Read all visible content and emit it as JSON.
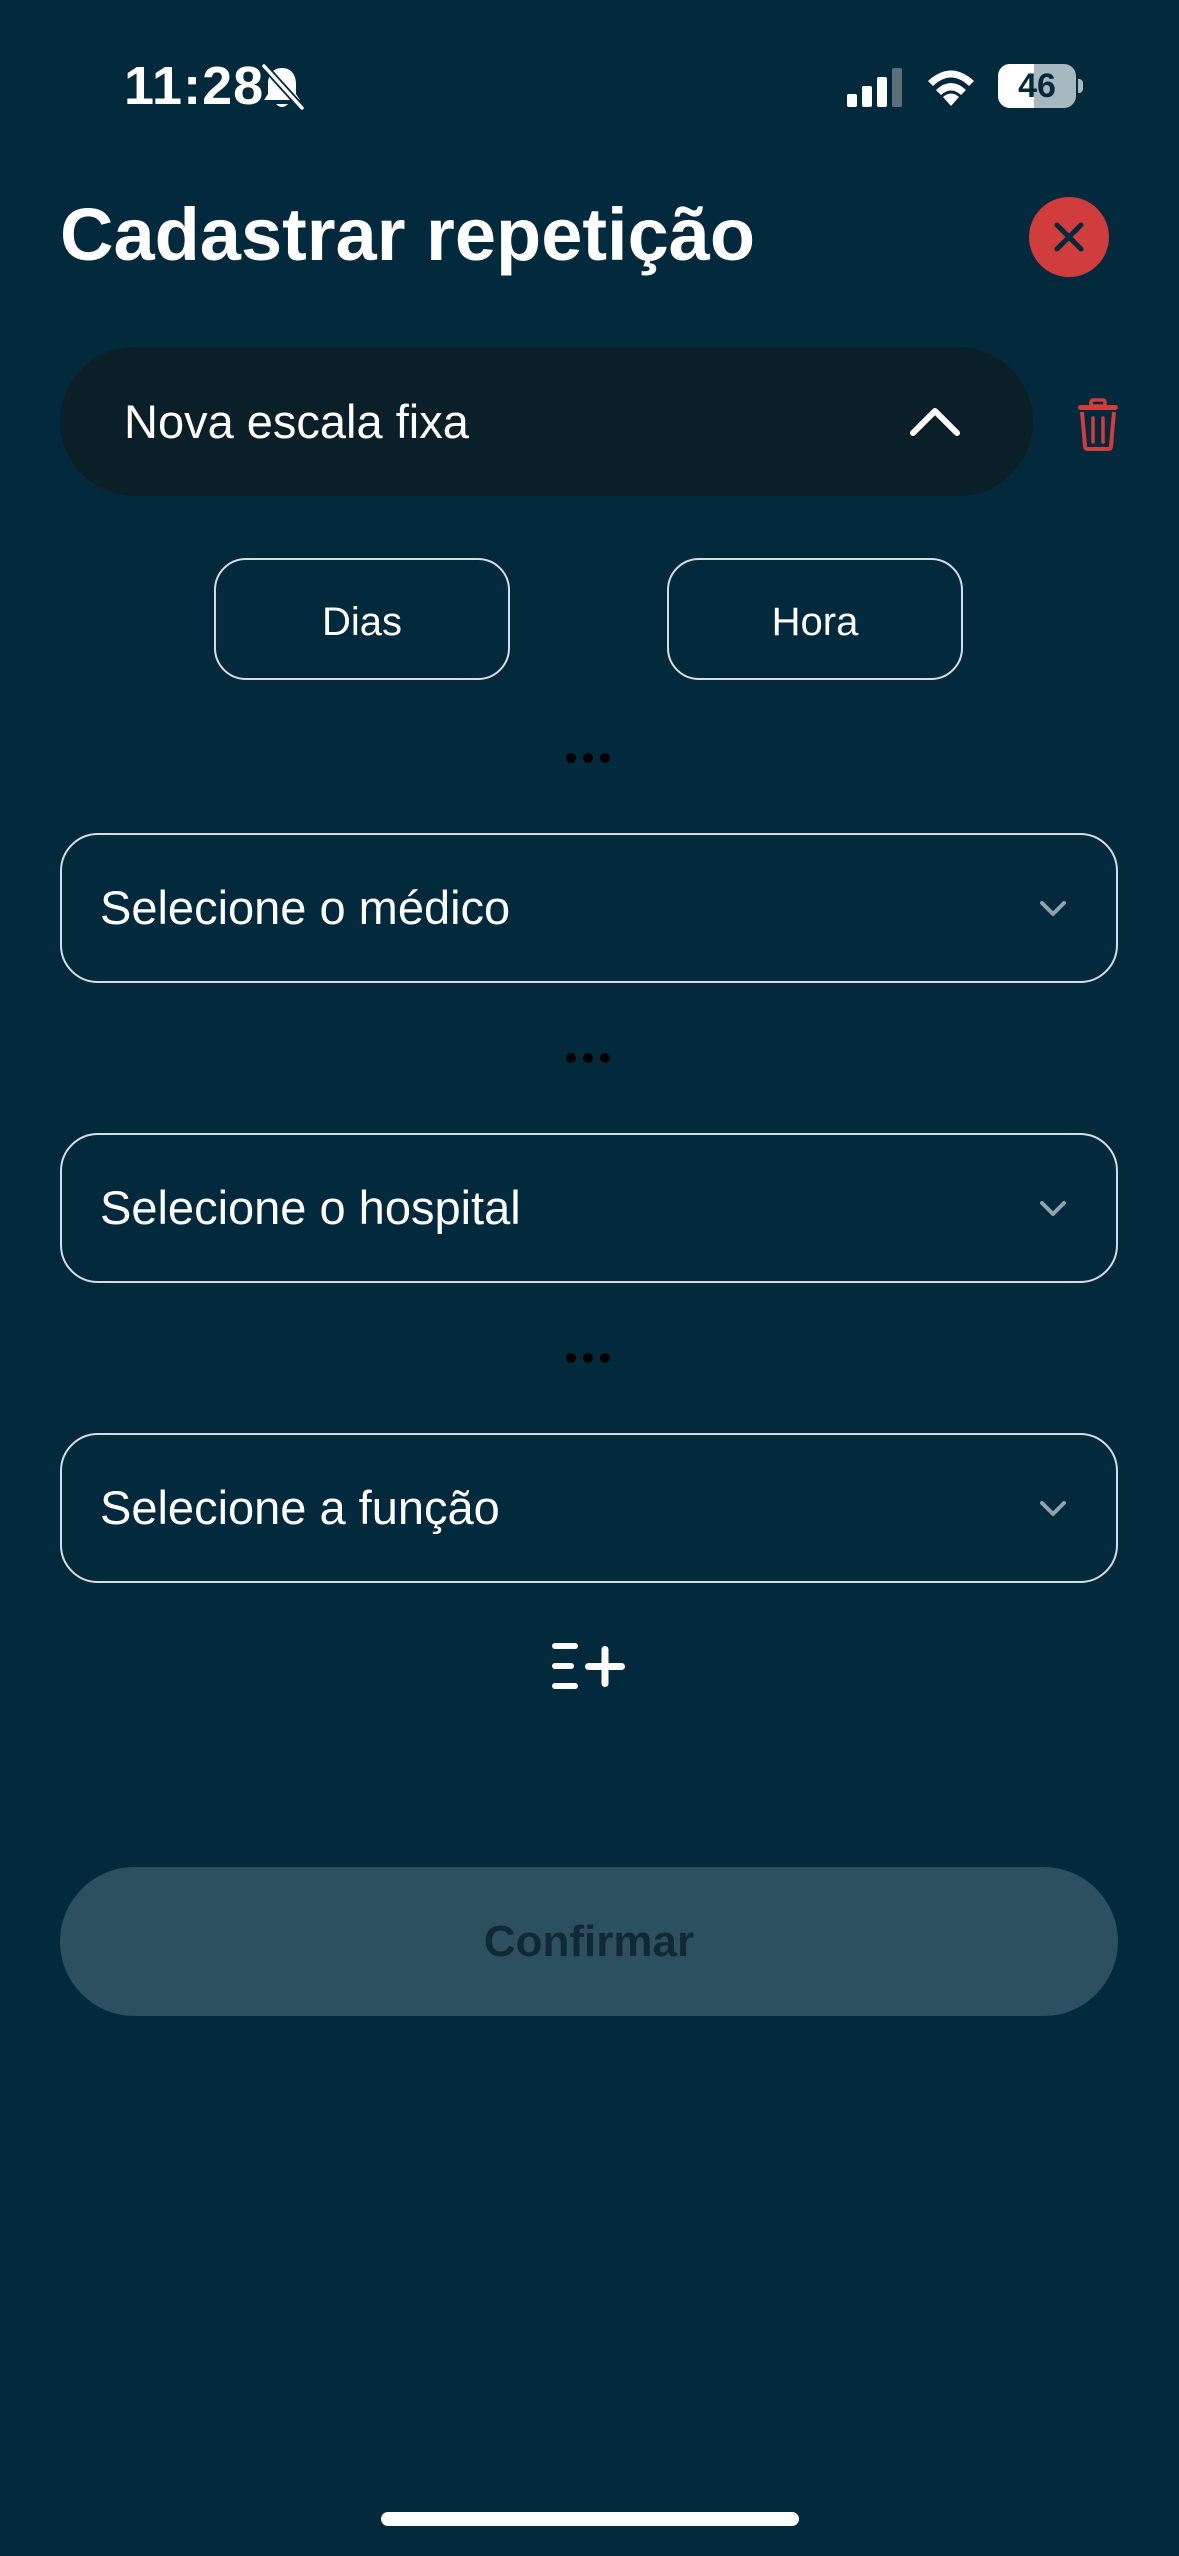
{
  "status_bar": {
    "time": "11:28",
    "battery_level": "46",
    "battery_fraction": 0.46,
    "icons": [
      "bell-slash-icon",
      "cellular-signal-icon",
      "wifi-icon",
      "battery-icon"
    ]
  },
  "header": {
    "title": "Cadastrar repetição",
    "close_icon": "close-icon"
  },
  "schedule": {
    "title": "Nova escala fixa",
    "expanded": true,
    "toggle_icon": "chevron-up-icon",
    "delete_icon": "trash-icon"
  },
  "time_options": {
    "days_label": "Dias",
    "hour_label": "Hora"
  },
  "fields": {
    "doctor_placeholder": "Selecione o médico",
    "hospital_placeholder": "Selecione o hospital",
    "role_placeholder": "Selecione a função"
  },
  "actions": {
    "add_item_icon": "list-add-icon",
    "confirm_label": "Confirmar",
    "confirm_enabled": false
  },
  "colors": {
    "background": "#03293d",
    "accordion": "#0b1f28",
    "close_button": "#d13d3d",
    "delete_icon": "#d13d3d",
    "field_border": "#d5dde1",
    "confirm_disabled": "#2c5060",
    "confirm_text_disabled": "#0f2a36"
  }
}
